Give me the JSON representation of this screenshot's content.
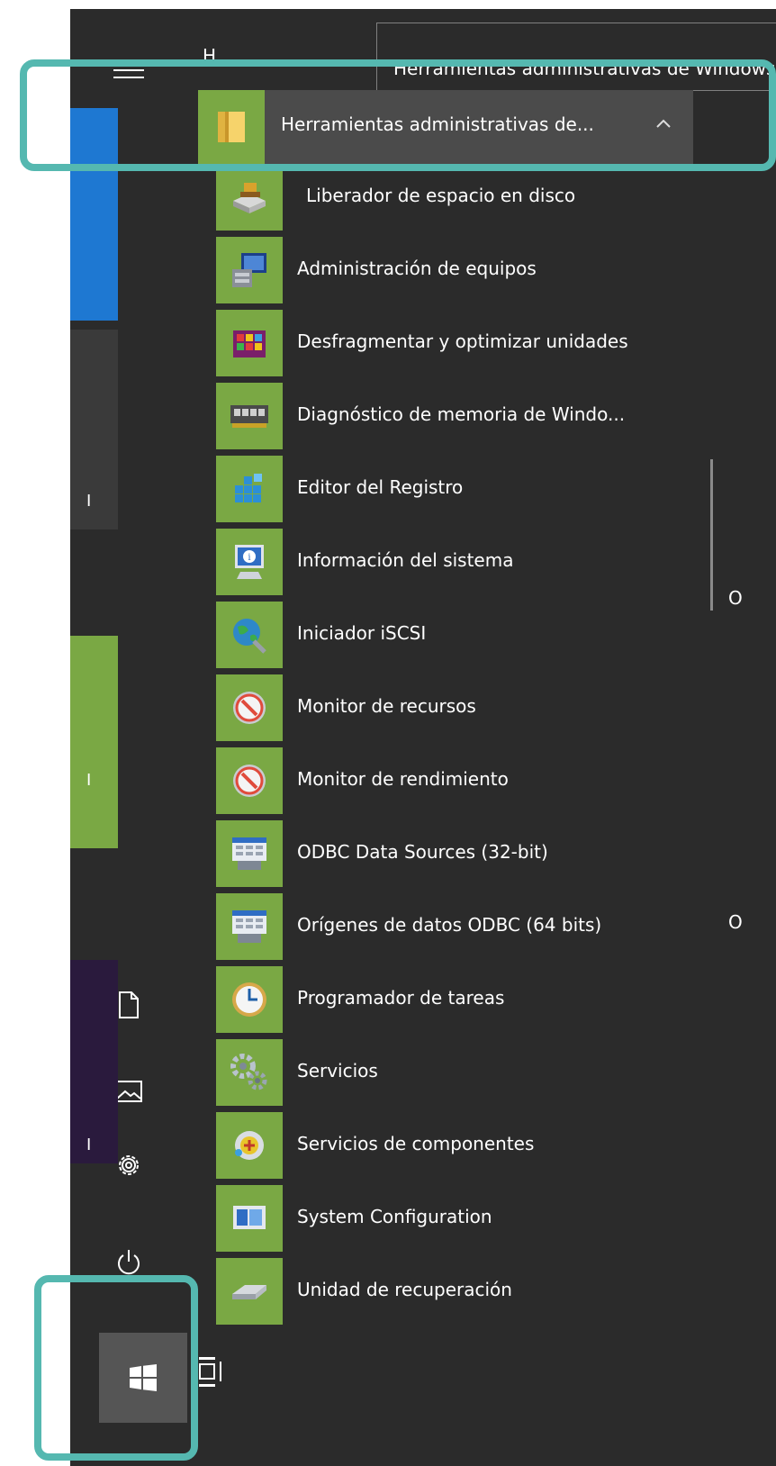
{
  "section_letter": "H",
  "tooltip": {
    "text": "Herramientas administrativas de Windows"
  },
  "folder": {
    "label": "Herramientas administrativas de...",
    "icon": "folder-icon"
  },
  "apps": [
    {
      "label": "Liberador de espacio en disco",
      "icon": "disk-cleanup-icon"
    },
    {
      "label": "Administración de equipos",
      "icon": "computer-management-icon"
    },
    {
      "label": "Desfragmentar y optimizar unidades",
      "icon": "defragment-icon"
    },
    {
      "label": "Diagnóstico de memoria de Windo...",
      "icon": "memory-chip-icon"
    },
    {
      "label": "Editor del Registro",
      "icon": "registry-editor-icon"
    },
    {
      "label": "Información del sistema",
      "icon": "system-info-icon"
    },
    {
      "label": "Iniciador iSCSI",
      "icon": "iscsi-globe-icon"
    },
    {
      "label": "Monitor de recursos",
      "icon": "resource-monitor-icon"
    },
    {
      "label": "Monitor de rendimiento",
      "icon": "performance-monitor-icon"
    },
    {
      "label": "ODBC Data Sources (32-bit)",
      "icon": "odbc-icon"
    },
    {
      "label": "Orígenes de datos ODBC (64 bits)",
      "icon": "odbc-icon"
    },
    {
      "label": "Programador de tareas",
      "icon": "clock-icon"
    },
    {
      "label": "Servicios",
      "icon": "gears-icon"
    },
    {
      "label": "Servicios de componentes",
      "icon": "component-services-icon"
    },
    {
      "label": "System Configuration",
      "icon": "system-config-icon"
    },
    {
      "label": "Unidad de recuperación",
      "icon": "recovery-drive-icon"
    }
  ],
  "right_panel": {
    "section_letters": [
      "O",
      "O"
    ],
    "tile_letters": [
      "I",
      "I",
      "I"
    ]
  },
  "colors": {
    "start_bg": "#2b2b2b",
    "tile_green": "#7aa844",
    "highlight": "#55b8b0",
    "tile_blue": "#1e78d2",
    "tile_purple": "#2a1a3d"
  },
  "rail_icons": [
    "hamburger-icon",
    "document-icon",
    "pictures-icon",
    "settings-icon",
    "power-icon",
    "windows-logo-icon",
    "task-view-icon"
  ]
}
